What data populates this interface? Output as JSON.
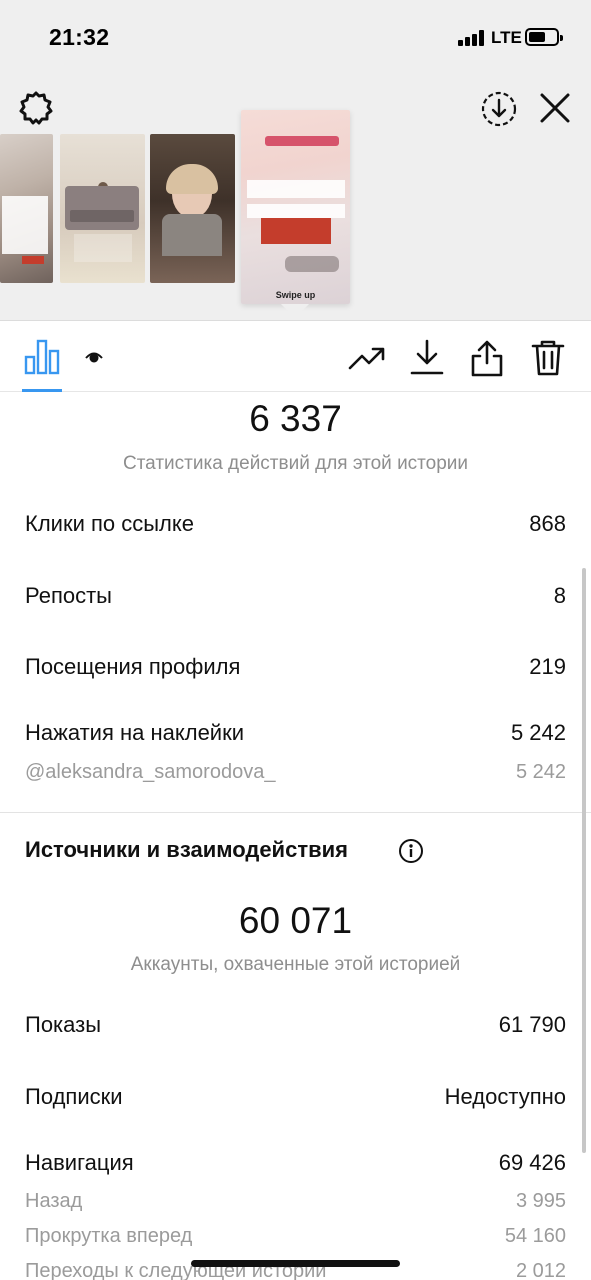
{
  "status_bar": {
    "time": "21:32",
    "network": "LTE"
  },
  "story_preview": {
    "swipe_up_label": "Swipe up"
  },
  "icons": {
    "settings": "gear-icon",
    "download_story": "download-circle-icon",
    "close": "close-icon",
    "stats_tab": "bar-chart-icon",
    "viewers_tab": "eye-icon",
    "promote": "trending-up-icon",
    "save": "download-icon",
    "share": "share-icon",
    "delete": "trash-icon",
    "info": "info-icon"
  },
  "colors": {
    "accent": "#3897f0",
    "muted": "#8e8e8e"
  },
  "actions_summary": {
    "total": "6 337",
    "caption": "Статистика действий для этой истории",
    "rows": [
      {
        "label": "Клики по ссылке",
        "value": "868"
      },
      {
        "label": "Репосты",
        "value": "8"
      },
      {
        "label": "Посещения профиля",
        "value": "219"
      },
      {
        "label": "Нажатия на наклейки",
        "value": "5 242"
      }
    ],
    "sticker_sub": {
      "label": "@aleksandra_samorodova_",
      "value": "5 242"
    }
  },
  "discovery": {
    "title": "Источники и взаимодействия",
    "total": "60 071",
    "caption": "Аккаунты, охваченные этой историей",
    "rows": [
      {
        "label": "Показы",
        "value": "61 790"
      },
      {
        "label": "Подписки",
        "value": "Недоступно"
      },
      {
        "label": "Навигация",
        "value": "69 426"
      }
    ],
    "navigation_sub": [
      {
        "label": "Назад",
        "value": "3 995"
      },
      {
        "label": "Прокрутка вперед",
        "value": "54 160"
      },
      {
        "label": "Переходы к следующей истории",
        "value": "2 012"
      }
    ]
  }
}
